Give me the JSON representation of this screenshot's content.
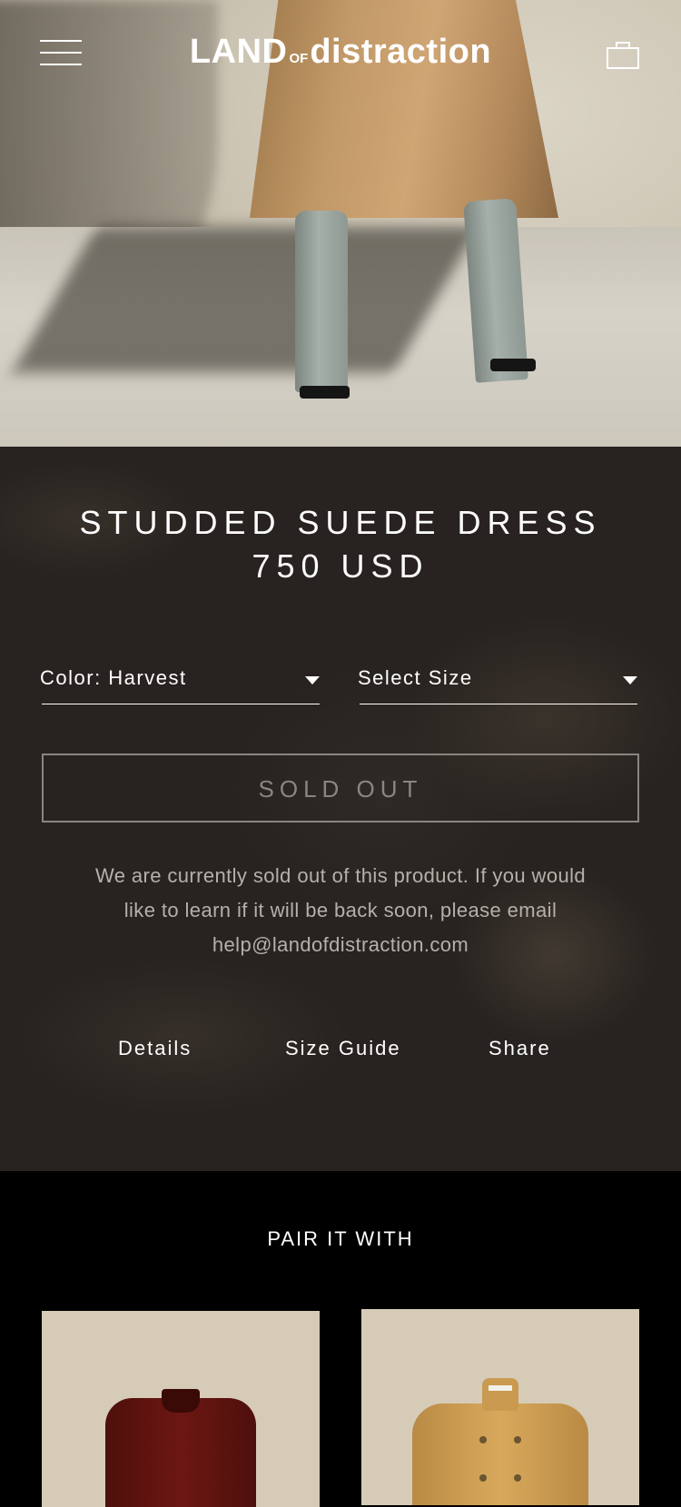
{
  "header": {
    "logo_part1": "LAND",
    "logo_part2": "OF",
    "logo_part3": "distraction",
    "menu_icon": "hamburger-menu-icon",
    "cart_icon": "shopping-bag-icon"
  },
  "product": {
    "name": "STUDDED SUEDE DRESS",
    "price": "750 USD",
    "color_select": "Color: Harvest",
    "size_select": "Select Size",
    "sold_out_button": "SOLD OUT",
    "sold_out_message": "We are currently sold out of this product. If you would like to learn if it will be back soon, please email help@landofdistraction.com",
    "links": [
      "Details",
      "Size Guide",
      "Share"
    ]
  },
  "pair": {
    "title": "PAIR IT WITH"
  },
  "colors": {
    "product_bg": "#282320",
    "pair_bg": "#000000",
    "card_bg": "#d6cbb7",
    "text": "#ffffff",
    "muted_text": "#b5b0aa"
  }
}
